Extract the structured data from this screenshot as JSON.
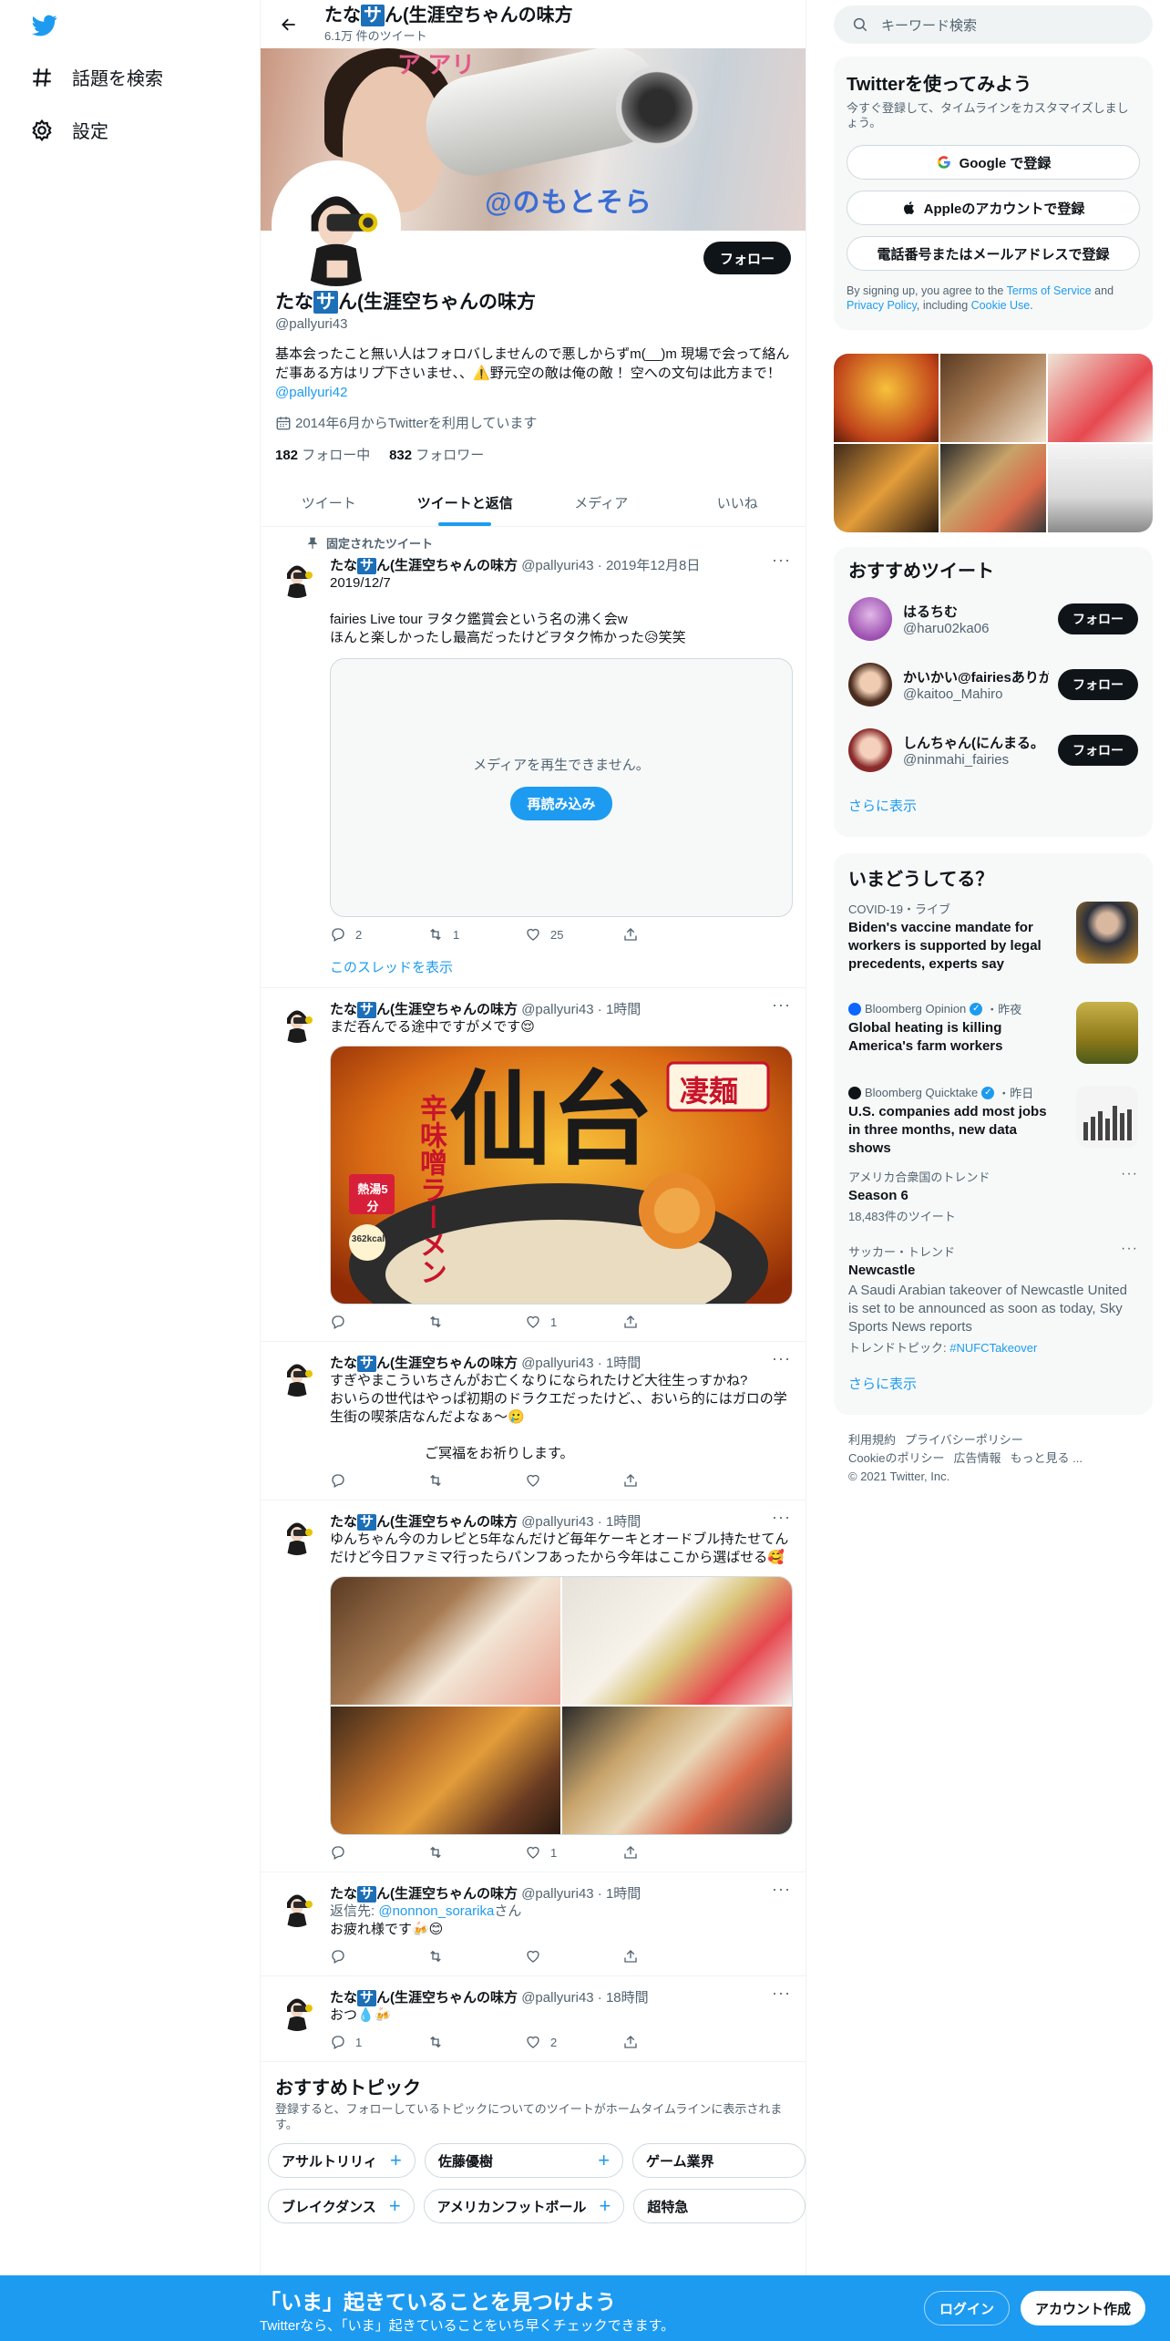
{
  "nav": {
    "explore_label": "話題を検索",
    "settings_label": "設定"
  },
  "header": {
    "name_pre": "たな",
    "name_sa": "サ",
    "name_post": "ん(生涯空ちゃんの味方",
    "tweet_count": "6.1万 件のツイート"
  },
  "banner": {
    "overlay_text": "@のもとそら",
    "top_text": "ア アリ"
  },
  "profile": {
    "follow_label": "フォロー",
    "handle": "@pallyuri43",
    "bio": "基本会ったこと無い人はフォロバしませんので悪しからずm(__)m 現場で会って絡んだ事ある方はリプ下さいませ、、⚠️野元空の敵は俺の敵 ！空への文句は此方まで！",
    "bio_link": "@pallyuri42",
    "joined": "2014年6月からTwitterを利用しています",
    "following_count": "182",
    "following_label": "フォロー中",
    "followers_count": "832",
    "followers_label": "フォロワー"
  },
  "tabs": [
    "ツイート",
    "ツイートと返信",
    "メディア",
    "いいね"
  ],
  "tweets": [
    {
      "pinned_label": "固定されたツイート",
      "meta": "@pallyuri43 · 2019年12月8日",
      "text1": "2019/12/7",
      "text2": "fairies Live tour ヲタク鑑賞会という名の沸く会w",
      "text3": "ほんと楽しかったし最高だったけどヲタク怖かった😥笑笑",
      "media_error": "メディアを再生できません。",
      "reload_label": "再読み込み",
      "replies": "2",
      "retweets": "1",
      "likes": "25",
      "thread_link": "このスレッドを表示"
    },
    {
      "meta": "@pallyuri43 · 1時間",
      "text1": "まだ呑んでる途中ですがメです😌",
      "likes": "1"
    },
    {
      "meta": "@pallyuri43 · 1時間",
      "text1": "すぎやまこういちさんがお亡くなりになられたけど大往生っすかね?",
      "text2": "おいらの世代はやっぱ初期のドラクエだったけど、、おいら的にはガロの学生街の喫茶店なんだよなぁ〜🥲",
      "text3": "ご冥福をお祈りします。"
    },
    {
      "meta": "@pallyuri43 · 1時間",
      "text1": "ゆんちゃん今のカレピと5年なんだけど毎年ケーキとオードブル持たせてんだけど今日ファミマ行ったらパンフあったから今年はここから選ばせる🥰",
      "likes": "1"
    },
    {
      "meta": "@pallyuri43 · 1時間",
      "reply_prefix": "返信先: ",
      "reply_to": "@nonnon_sorarika",
      "reply_suffix": "さん",
      "text1": "お疲れ様です🍻😊"
    },
    {
      "meta": "@pallyuri43 · 18時間",
      "text1": "おつ💧🍻",
      "replies": "1",
      "likes": "2"
    }
  ],
  "ramen": {
    "big": "仙台",
    "label": "辛味噌ラーメン",
    "tag": "凄麺",
    "hot": "熱湯5分",
    "kcal": "362kcal"
  },
  "topics": {
    "title": "おすすめトピック",
    "desc": "登録すると、フォローしているトピックについてのツイートがホームタイムラインに表示されます。",
    "row1": [
      "アサルトリリィ",
      "佐藤優樹",
      "ゲーム業界"
    ],
    "row2": [
      "ブレイクダンス",
      "アメリカンフットボール",
      "超特急"
    ]
  },
  "search": {
    "placeholder": "キーワード検索"
  },
  "signup": {
    "title": "Twitterを使ってみよう",
    "sub": "今すぐ登録して、タイムラインをカスタマイズしましょう。",
    "google": "Google で登録",
    "apple": "Appleのアカウントで登録",
    "phone": "電話番号またはメールアドレスで登録",
    "terms_pre": "By signing up, you agree to the ",
    "terms_tos": "Terms of Service",
    "terms_and": " and ",
    "terms_privacy": "Privacy Policy",
    "terms_mid": ", including ",
    "terms_cookie": "Cookie Use",
    "terms_end": "."
  },
  "recs": {
    "title": "おすすめツイート",
    "users": [
      {
        "name": "はるちむ",
        "handle": "@haru02ka06",
        "follow": "フォロー"
      },
      {
        "name": "かいかい@fairiesありが",
        "handle": "@kaitoo_Mahiro",
        "follow": "フォロー"
      },
      {
        "name": "しんちゃん(にんまる。",
        "handle": "@ninmahi_fairies",
        "follow": "フォロー"
      }
    ],
    "more": "さらに表示"
  },
  "trends": {
    "title": "いまどうしてる？",
    "items": [
      {
        "context": "COVID-19・ライブ",
        "title": "Biden's vaccine mandate for workers is supported by legal precedents, experts say"
      },
      {
        "context": "Bloomberg Opinion",
        "context_suffix": "・昨夜",
        "title": "Global heating is killing America's farm workers"
      },
      {
        "context": "Bloomberg Quicktake",
        "context_suffix": "・昨日",
        "title": "U.S. companies add most jobs in three months, new data shows"
      },
      {
        "context": "アメリカ合衆国のトレンド",
        "title": "Season 6",
        "count": "18,483件のツイート"
      },
      {
        "context": "サッカー・トレンド",
        "title": "Newcastle",
        "desc": "A Saudi Arabian takeover of Newcastle United is set to be announced as soon as today, Sky Sports News reports",
        "topic_prefix": "トレンドトピック: ",
        "topic_tag": "#NUFCTakeover"
      }
    ],
    "more": "さらに表示"
  },
  "footer": {
    "terms": "利用規約",
    "privacy": "プライバシーポリシー",
    "cookie": "Cookieのポリシー",
    "ads": "広告情報",
    "more": "もっと見る ...",
    "copyright": "© 2021 Twitter, Inc."
  },
  "bottombar": {
    "title": "「いま」起きていることを見つけよう",
    "sub": "Twitterなら、「いま」起きていることをいち早くチェックできます。",
    "login": "ログイン",
    "signup": "アカウント作成"
  },
  "colors": {
    "accent": "#1d9bf0",
    "dark": "#0f1419",
    "muted": "#536471"
  }
}
